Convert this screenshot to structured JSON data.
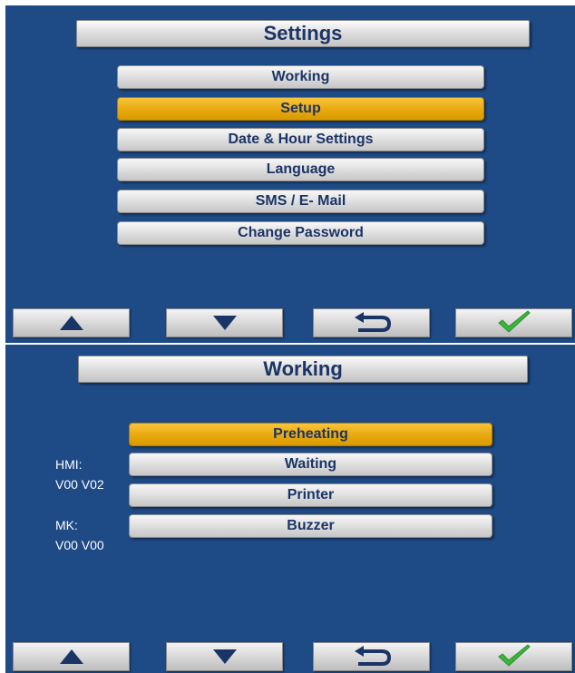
{
  "settings": {
    "title": "Settings",
    "menu": [
      "Working",
      "Setup",
      "Date & Hour Settings",
      "Language",
      "SMS / E- Mail",
      "Change Password"
    ],
    "selected": "Setup"
  },
  "working": {
    "title": "Working",
    "menu": [
      "Preheating",
      "Waiting",
      "Printer",
      "Buzzer"
    ],
    "selected": "Preheating",
    "hmi_label": "HMI:",
    "hmi_version": "V00 V02",
    "mk_label": "MK:",
    "mk_version": "V00 V00"
  },
  "nav": {
    "buttons": [
      "up-arrow-icon",
      "down-arrow-icon",
      "back-return-icon",
      "confirm-check-icon"
    ]
  },
  "colors": {
    "background": "#1e4a86",
    "selected": "#e8a80e",
    "button_text": "#1b3466",
    "check": "#3cb53c"
  }
}
